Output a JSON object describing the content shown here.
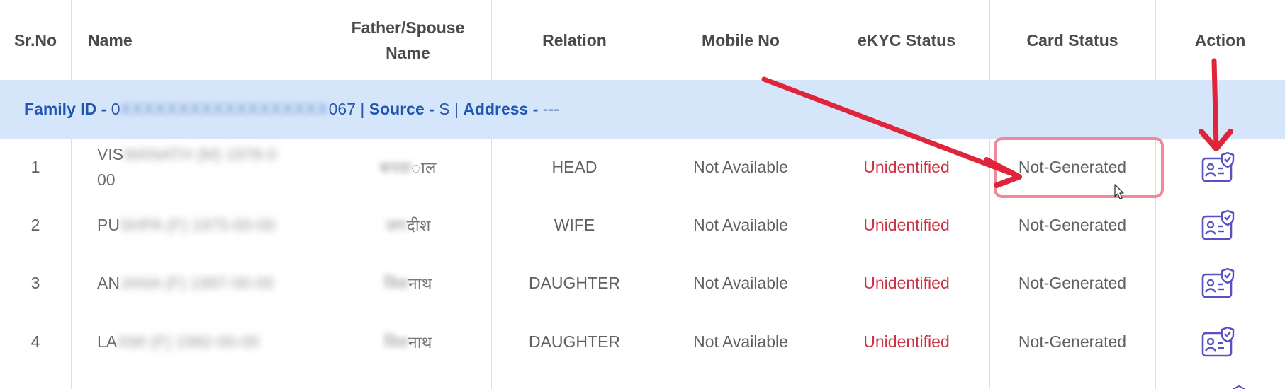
{
  "headers": {
    "sr_no": "Sr.No",
    "name": "Name",
    "father_line1": "Father/Spouse",
    "father_line2": "Name",
    "relation": "Relation",
    "mobile": "Mobile No",
    "ekyc": "eKYC Status",
    "card": "Card Status",
    "action": "Action"
  },
  "family": {
    "id_label": "Family ID -",
    "id_prefix": "0",
    "id_redacted": "XXXXXXXXXXXXXXXXXX",
    "id_suffix": "067",
    "sep1": "|",
    "source_label": "Source -",
    "source_value": "S",
    "sep2": "|",
    "address_label": "Address -",
    "address_value": "---"
  },
  "rows": [
    {
      "sr": "1",
      "name_visible": "VIS",
      "name_redacted": "WANATH (M) 1978-0",
      "name_line2": "00",
      "father_redacted": "बनवा",
      "father_visible": "ाल",
      "relation": "HEAD",
      "mobile": "Not Available",
      "ekyc": "Unidentified",
      "card": "Not-Generated"
    },
    {
      "sr": "2",
      "name_visible": "PU",
      "name_redacted": "SHPA (F) 1975-00-00",
      "name_line2": "",
      "father_redacted": "जग",
      "father_visible": "दीश",
      "relation": "WIFE",
      "mobile": "Not Available",
      "ekyc": "Unidentified",
      "card": "Not-Generated"
    },
    {
      "sr": "3",
      "name_visible": "AN",
      "name_redacted": "JANA (F) 1997-00-00",
      "name_line2": "",
      "father_redacted": "विश",
      "father_visible": "नाथ",
      "relation": "DAUGHTER",
      "mobile": "Not Available",
      "ekyc": "Unidentified",
      "card": "Not-Generated"
    },
    {
      "sr": "4",
      "name_visible": "LA",
      "name_redacted": "XMI (F) 1992-00-00",
      "name_line2": "",
      "father_redacted": "विश",
      "father_visible": "नाथ",
      "relation": "DAUGHTER",
      "mobile": "Not Available",
      "ekyc": "Unidentified",
      "card": "Not-Generated"
    }
  ],
  "colors": {
    "family_band": "#d6e6fa",
    "unidentified": "#cc3344",
    "icon": "#5b4fc4",
    "annotation_arrow": "#e0243a",
    "highlight_box": "#ef8a9a"
  },
  "icons": {
    "action": "card-verify-icon",
    "cursor": "mouse-pointer-icon"
  }
}
